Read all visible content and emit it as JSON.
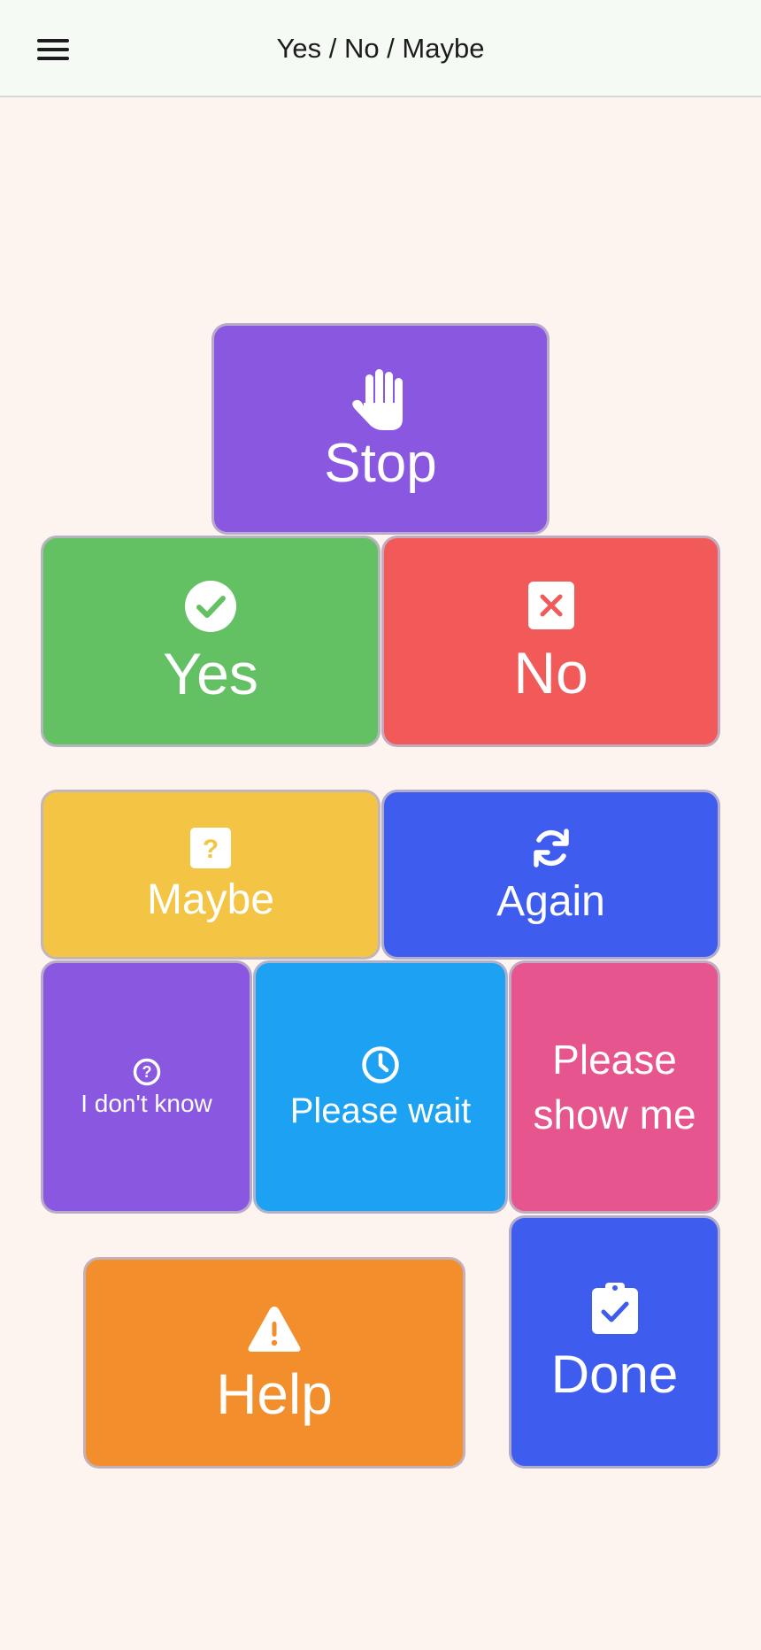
{
  "header": {
    "title": "Yes / No / Maybe",
    "menu_icon": "hamburger-menu-icon"
  },
  "tiles": {
    "stop": {
      "label": "Stop",
      "icon": "hand-icon",
      "color": "#8a57e0"
    },
    "yes": {
      "label": "Yes",
      "icon": "check-circle-icon",
      "color": "#63c063"
    },
    "no": {
      "label": "No",
      "icon": "x-square-icon",
      "color": "#f25a5a"
    },
    "maybe": {
      "label": "Maybe",
      "icon": "question-square-icon",
      "color": "#f4c544"
    },
    "again": {
      "label": "Again",
      "icon": "refresh-icon",
      "color": "#3e5def"
    },
    "dont_know": {
      "label": "I don't know",
      "icon": "question-circle-icon",
      "color": "#8a57e0"
    },
    "wait": {
      "label": "Please wait",
      "icon": "clock-icon",
      "color": "#1da1f2"
    },
    "show_me": {
      "label": "Please show me",
      "icon": "",
      "color": "#e6558d"
    },
    "help": {
      "label": "Help",
      "icon": "warning-icon",
      "color": "#f28e2c"
    },
    "done": {
      "label": "Done",
      "icon": "clipboard-check-icon",
      "color": "#3e5def"
    }
  }
}
